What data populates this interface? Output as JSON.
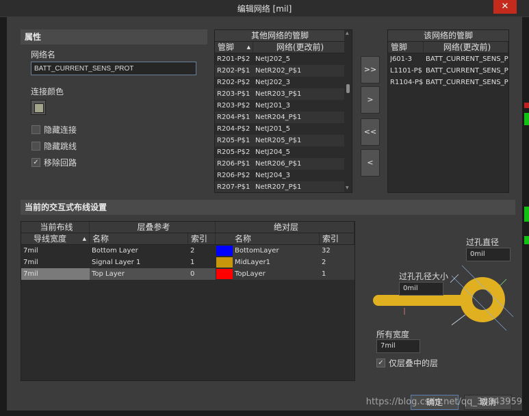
{
  "window": {
    "title": "编辑网络 [mil]",
    "close_glyph": "✕"
  },
  "properties": {
    "header": "属性",
    "net_name_label": "网络名",
    "net_name_value": "BATT_CURRENT_SENS_PROT",
    "color_label": "连接颜色",
    "color_value": "#a3a58a",
    "hide_connection": {
      "label": "隐藏连接",
      "checked": false
    },
    "hide_jump": {
      "label": "隐藏跳线",
      "checked": false
    },
    "remove_loops": {
      "label": "移除回路",
      "checked": true
    }
  },
  "other_pins": {
    "header": "其他网络的管脚",
    "col_pin": "管脚",
    "col_net": "网络(更改前)",
    "rows": [
      {
        "pin": "R201-P$2",
        "net": "NetJ202_5"
      },
      {
        "pin": "R202-P$1",
        "net": "NetR202_P$1"
      },
      {
        "pin": "R202-P$2",
        "net": "NetJ202_3"
      },
      {
        "pin": "R203-P$1",
        "net": "NetR203_P$1"
      },
      {
        "pin": "R203-P$2",
        "net": "NetJ201_3"
      },
      {
        "pin": "R204-P$1",
        "net": "NetR204_P$1"
      },
      {
        "pin": "R204-P$2",
        "net": "NetJ201_5"
      },
      {
        "pin": "R205-P$1",
        "net": "NetR205_P$1"
      },
      {
        "pin": "R205-P$2",
        "net": "NetJ204_5"
      },
      {
        "pin": "R206-P$1",
        "net": "NetR206_P$1"
      },
      {
        "pin": "R206-P$2",
        "net": "NetJ204_3"
      },
      {
        "pin": "R207-P$1",
        "net": "NetR207_P$1"
      }
    ]
  },
  "transfer": {
    "add_all": ">>",
    "add": ">",
    "remove_all": "<<",
    "remove": "<"
  },
  "this_pins": {
    "header": "该网络的管脚",
    "col_pin": "管脚",
    "col_net": "网络(更改前)",
    "rows": [
      {
        "pin": "J601-3",
        "net": "BATT_CURRENT_SENS_P"
      },
      {
        "pin": "L1101-P$",
        "net": "BATT_CURRENT_SENS_P"
      },
      {
        "pin": "R1104-P$",
        "net": "BATT_CURRENT_SENS_P"
      }
    ]
  },
  "routing": {
    "header": "当前的交互式布线设置",
    "group_current": "当前布线",
    "group_stack": "层叠参考",
    "group_abs": "绝对层",
    "col_width": "导线宽度",
    "col_name": "名称",
    "col_index": "索引",
    "col_abs_name": "名称",
    "col_abs_index": "索引",
    "rows": [
      {
        "width": "7mil",
        "name": "Bottom Layer",
        "index": "2",
        "abs_name": "BottomLayer",
        "abs_color": "#0000ff",
        "abs_index": "32"
      },
      {
        "width": "7mil",
        "name": "Signal Layer 1",
        "index": "1",
        "abs_name": "MidLayer1",
        "abs_color": "#c8960a",
        "abs_index": "2"
      },
      {
        "width": "7mil",
        "name": "Top Layer",
        "index": "0",
        "abs_name": "TopLayer",
        "abs_color": "#ff0000",
        "abs_index": "1"
      }
    ]
  },
  "via": {
    "diameter_label": "过孔直径",
    "diameter_value": "0mil",
    "hole_label": "过孔孔径大小",
    "hole_value": "0mil",
    "width_label": "所有宽度",
    "width_value": "7mil",
    "stack_only": {
      "label": "仅层叠中的层",
      "checked": true
    },
    "track_color": "#e0b020"
  },
  "footer": {
    "ok": "确定",
    "cancel": "取消",
    "watermark": "https://blog.csdn.net/qq_38843959"
  }
}
